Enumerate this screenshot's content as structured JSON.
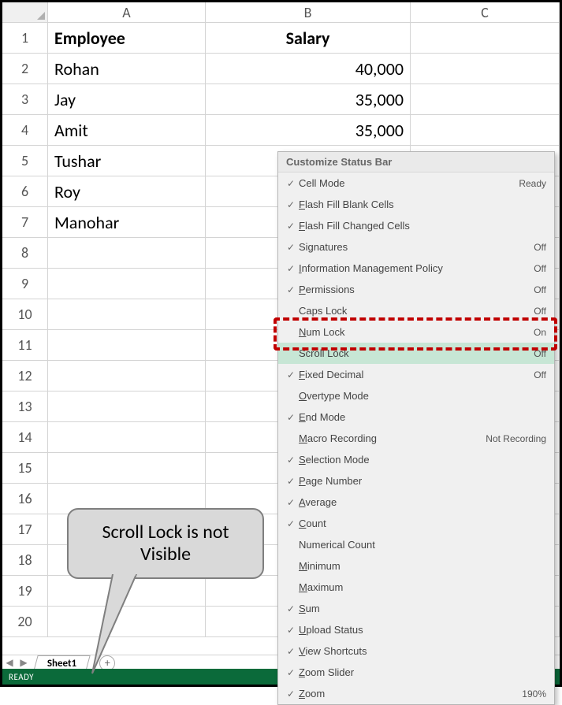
{
  "columns": [
    "A",
    "B",
    "C"
  ],
  "row_headers": [
    "1",
    "2",
    "3",
    "4",
    "5",
    "6",
    "7",
    "8",
    "9",
    "10",
    "11",
    "12",
    "13",
    "14",
    "15",
    "16",
    "17",
    "18",
    "19",
    "20"
  ],
  "cells": {
    "A1": "Employee",
    "B1": "Salary",
    "A2": "Rohan",
    "B2": "40,000",
    "A3": "Jay",
    "B3": "35,000",
    "A4": "Amit",
    "B4": "35,000",
    "A5": "Tushar",
    "A6": "Roy",
    "A7": "Manohar"
  },
  "sheet_tab": "Sheet1",
  "status": "READY",
  "menu": {
    "title": "Customize Status Bar",
    "items": [
      {
        "checked": true,
        "label": "Cell Mode",
        "ukey": "",
        "value": "Ready"
      },
      {
        "checked": true,
        "label": "Flash Fill Blank Cells",
        "ukey": "F",
        "value": ""
      },
      {
        "checked": true,
        "label": "Flash Fill Changed Cells",
        "ukey": "F",
        "value": ""
      },
      {
        "checked": true,
        "label": "Signatures",
        "ukey": "",
        "value": "Off"
      },
      {
        "checked": true,
        "label": "Information Management Policy",
        "ukey": "I",
        "value": "Off"
      },
      {
        "checked": true,
        "label": "Permissions",
        "ukey": "P",
        "value": "Off"
      },
      {
        "checked": false,
        "label": "Caps Lock",
        "ukey": "",
        "value": "Off"
      },
      {
        "checked": false,
        "label": "Num Lock",
        "ukey": "N",
        "value": "On"
      },
      {
        "checked": false,
        "label": "Scroll Lock",
        "ukey": "",
        "value": "Off",
        "highlight": true
      },
      {
        "checked": true,
        "label": "Fixed Decimal",
        "ukey": "F",
        "value": "Off"
      },
      {
        "checked": false,
        "label": "Overtype Mode",
        "ukey": "O",
        "value": ""
      },
      {
        "checked": true,
        "label": "End Mode",
        "ukey": "E",
        "value": ""
      },
      {
        "checked": false,
        "label": "Macro Recording",
        "ukey": "M",
        "value": "Not Recording"
      },
      {
        "checked": true,
        "label": "Selection Mode",
        "ukey": "S",
        "value": ""
      },
      {
        "checked": true,
        "label": "Page Number",
        "ukey": "P",
        "value": ""
      },
      {
        "checked": true,
        "label": "Average",
        "ukey": "A",
        "value": ""
      },
      {
        "checked": true,
        "label": "Count",
        "ukey": "C",
        "value": ""
      },
      {
        "checked": false,
        "label": "Numerical Count",
        "ukey": "",
        "value": ""
      },
      {
        "checked": false,
        "label": "Minimum",
        "ukey": "M",
        "value": ""
      },
      {
        "checked": false,
        "label": "Maximum",
        "ukey": "M",
        "value": ""
      },
      {
        "checked": true,
        "label": "Sum",
        "ukey": "S",
        "value": ""
      },
      {
        "checked": true,
        "label": "Upload Status",
        "ukey": "U",
        "value": ""
      },
      {
        "checked": true,
        "label": "View Shortcuts",
        "ukey": "V",
        "value": ""
      },
      {
        "checked": true,
        "label": "Zoom Slider",
        "ukey": "Z",
        "value": ""
      },
      {
        "checked": true,
        "label": "Zoom",
        "ukey": "Z",
        "value": "190%"
      }
    ]
  },
  "callout_text": "Scroll Lock is not Visible"
}
